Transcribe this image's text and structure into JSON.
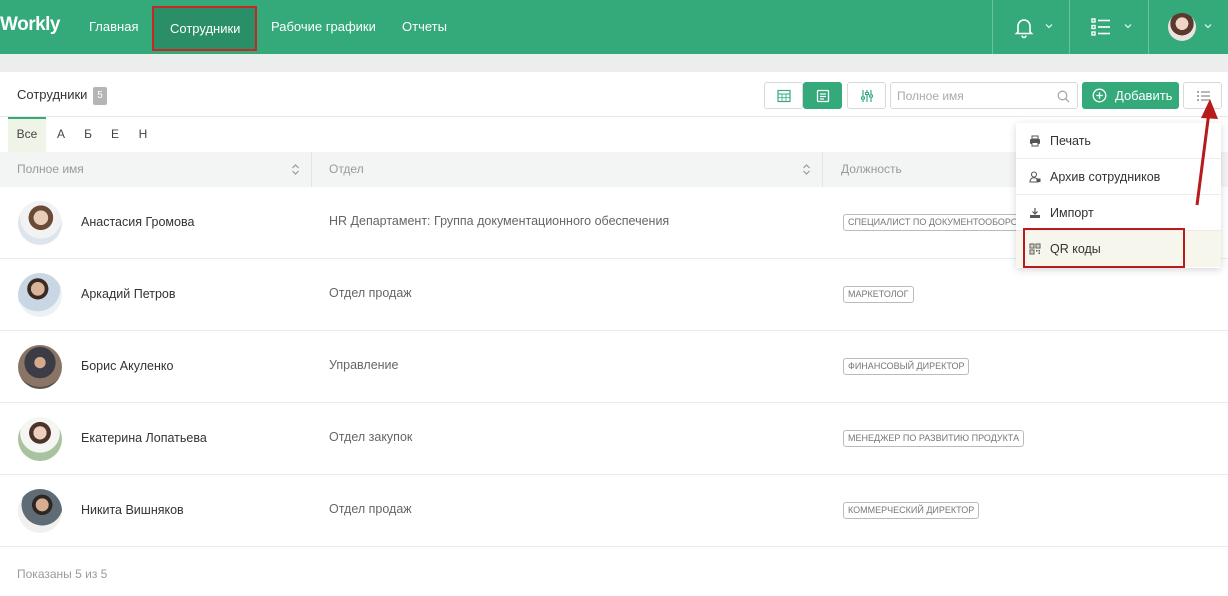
{
  "app": {
    "logo": "Workly"
  },
  "nav": {
    "items": [
      {
        "label": "Главная"
      },
      {
        "label": "Сотрудники"
      },
      {
        "label": "Рабочие графики"
      },
      {
        "label": "Отчеты"
      }
    ]
  },
  "toolbar": {
    "title": "Сотрудники",
    "count": "5",
    "search_placeholder": "Полное имя",
    "add_label": "Добавить"
  },
  "letters": [
    "Все",
    "А",
    "Б",
    "Е",
    "Н"
  ],
  "table": {
    "headers": [
      "Полное имя",
      "Отдел",
      "Должность"
    ],
    "rows": [
      {
        "name": "Анастасия Громова",
        "department": "HR Департамент: Группа документационного обеспечения",
        "position": "СПЕЦИАЛИСТ ПО ДОКУМЕНТООБОРОТУ"
      },
      {
        "name": "Аркадий Петров",
        "department": "Отдел продаж",
        "position": "МАРКЕТОЛОГ"
      },
      {
        "name": "Борис Акуленко",
        "department": "Управление",
        "position": "ФИНАНСОВЫЙ ДИРЕКТОР"
      },
      {
        "name": "Екатерина Лопатьева",
        "department": "Отдел закупок",
        "position": "МЕНЕДЖЕР ПО РАЗВИТИЮ ПРОДУКТА"
      },
      {
        "name": "Никита Вишняков",
        "department": "Отдел продаж",
        "position": "КОММЕРЧЕСКИЙ ДИРЕКТОР"
      }
    ],
    "footer": "Показаны 5 из 5"
  },
  "dropdown": {
    "items": [
      {
        "label": "Печать",
        "icon": "printer-icon"
      },
      {
        "label": "Архив сотрудников",
        "icon": "user-archive-icon"
      },
      {
        "label": "Импорт",
        "icon": "import-icon"
      },
      {
        "label": "QR коды",
        "icon": "qr-code-icon"
      }
    ]
  },
  "colors": {
    "primary": "#34a97a",
    "highlight": "#c62828"
  }
}
